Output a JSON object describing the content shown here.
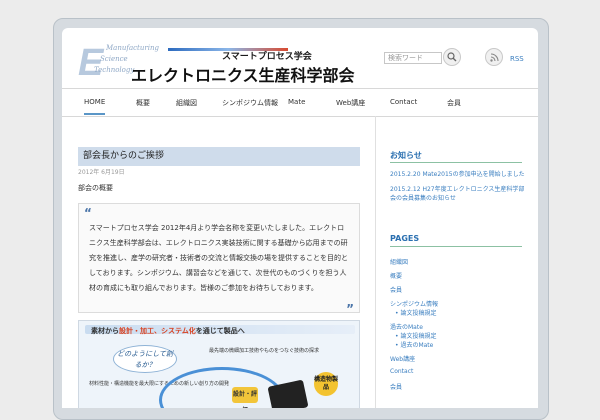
{
  "logo": {
    "en_line1": "Manufacturing",
    "en_line2": "Science",
    "en_line3": "Technology",
    "initial": "E",
    "jp_small": "スマートプロセス学会",
    "jp_big": "エレクトロニクス生産科学部会"
  },
  "header": {
    "search_placeholder": "検索ワード",
    "rss_label": "RSS"
  },
  "nav": {
    "items": [
      "HOME",
      "概要",
      "組織図",
      "シンポジウム情報",
      "Mate",
      "Web講座",
      "Contact",
      "会員"
    ]
  },
  "post": {
    "title": "部会長からのご挨拶",
    "date": "2012年 6月19日",
    "lead": "部会の概要",
    "quote": "スマートプロセス学会 2012年4月より学会名称を変更いたしました。エレクトロニクス生産科学部会は、エレクトロニクス実装技術に関する基礎から応用までの研究を推進し、産学の研究者・技術者の交流と情報交換の場を提供することを目的としております。シンポジウム、講習会などを通じて、次世代のものづくりを担う人材の育成にも取り組んでおります。皆様のご参加をお待ちしております。"
  },
  "banner": {
    "headline_prefix": "素材から",
    "headline_red": "設計・加工、システム化",
    "headline_suffix": "を通じて製品へ",
    "bubble": "どのようにして創るか？",
    "note1": "最先端の微細加工技術やものをつなぐ技術の探求",
    "note2": "材料性能・構造機能を最大限にするための新しい創り方の開発",
    "eval": "設計・評価",
    "product": "構造物製品"
  },
  "sidebar": {
    "news_heading": "お知らせ",
    "news": [
      "2015.2.20 Mate2015の参加申込を開始しました",
      "2015.2.12 H27年度エレクトロニクス生産科学部会の会員募集のお知らせ"
    ],
    "pages_heading": "PAGES",
    "pages": [
      "組織図",
      "概要",
      "会員",
      "シンポジウム情報",
      "過去のMate"
    ],
    "subpages": [
      "論文投稿規定",
      "過去のMate"
    ],
    "pages_tail": [
      "Web講座",
      "Contact",
      "会員"
    ]
  },
  "colors": {
    "accent": "#3b7fc0",
    "title_bg": "#cfdceb",
    "divider_green": "#8cc1a3"
  }
}
